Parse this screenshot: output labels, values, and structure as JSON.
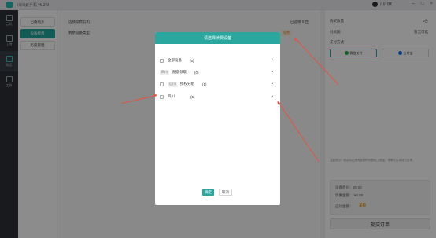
{
  "title": "川川云手机 v6.2.9",
  "user": "川川家",
  "nav": [
    {
      "label": "云机"
    },
    {
      "label": "上传"
    },
    {
      "label": "购买"
    },
    {
      "label": "工具"
    }
  ],
  "subnav": [
    {
      "label": "已备购买"
    },
    {
      "label": "设备续费"
    },
    {
      "label": "历史管理"
    }
  ],
  "main": {
    "row1_label": "选择续费云机",
    "row1_value": "已选择 0 台",
    "row2_label": "剩余设备类型",
    "row2_chip": "续费"
  },
  "right": {
    "qty_label": "购买数量",
    "qty_value": "0台",
    "duration_label": "付款期",
    "duration_value": "暂无可选",
    "pay_label": "支付方式",
    "wechat": "微信支付",
    "alipay": "支付宝",
    "note": "温馨提示：续费将在原有到期时间基础上顺延，请确认后再提交订单。",
    "original_label": "设备原价：¥0.00",
    "discount_label": "优惠金额：-¥0.00",
    "pay_total_label": "应付金额：",
    "pay_total": "¥0",
    "submit": "提交订单"
  },
  "modal": {
    "title": "请选择续费设备",
    "rows": [
      {
        "tag": "",
        "name": "全部设备",
        "count": "(6)"
      },
      {
        "tag": "四川",
        "name": "随意领取",
        "count": "(0)"
      },
      {
        "tag": "山川",
        "name": "授权分组",
        "count": "(1)"
      },
      {
        "tag": "",
        "name": "四川",
        "count": "(5)"
      }
    ],
    "confirm": "确定",
    "cancel": "取消"
  },
  "colors": {
    "accent": "#2aa79f",
    "arrow": "#e8533f"
  }
}
